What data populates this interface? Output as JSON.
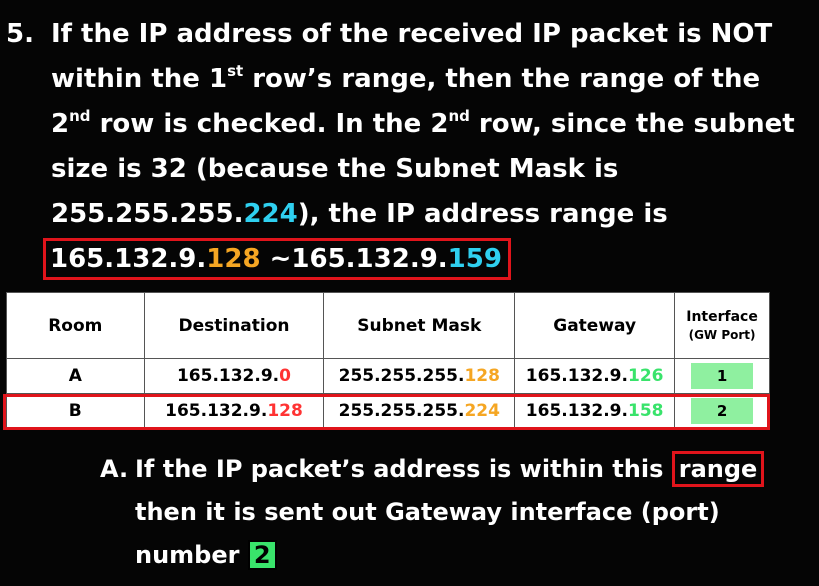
{
  "step": {
    "number": "5.",
    "l1": "If the IP address of the received IP packet is NOT",
    "l2a": "within the 1",
    "l2sup": "st",
    "l2b": " row’s range, then the range of the",
    "l3a": "2",
    "l3sup": "nd",
    "l3b": " row is checked. In the 2",
    "l3sup2": "nd",
    "l3c": " row, since the subnet",
    "l4": "size is 32 (because the Subnet Mask is",
    "l5a": "255.255.255.",
    "l5b": "224",
    "l5c": "), the IP address range is",
    "range_a": "165.132.9.",
    "range_b": "128",
    "range_c": " ~165.132.9.",
    "range_d": "159"
  },
  "table": {
    "headers": [
      "Room",
      "Destination",
      "Subnet Mask",
      "Gateway"
    ],
    "iface_header": "Interface",
    "iface_sub": "(GW Port)",
    "rows": [
      {
        "room": "A",
        "dest_prefix": "165.132.9.",
        "dest_suffix": "0",
        "mask_prefix": "255.255.255.",
        "mask_suffix": "128",
        "gw_prefix": "165.132.9.",
        "gw_suffix": "126",
        "iface": "1"
      },
      {
        "room": "B",
        "dest_prefix": "165.132.9.",
        "dest_suffix": "128",
        "mask_prefix": "255.255.255.",
        "mask_suffix": "224",
        "gw_prefix": "165.132.9.",
        "gw_suffix": "158",
        "iface": "2"
      }
    ]
  },
  "note": {
    "marker": "A.",
    "l1a": "If the IP packet’s address is within this ",
    "l1b": "range",
    "l2": "then it is sent out Gateway interface (port)",
    "l3a": "number ",
    "l3b": "2"
  },
  "colors": {
    "accent_red": "#e0141b",
    "cyan": "#2fd0f0",
    "orange": "#f5a623",
    "green": "#39e36b"
  }
}
